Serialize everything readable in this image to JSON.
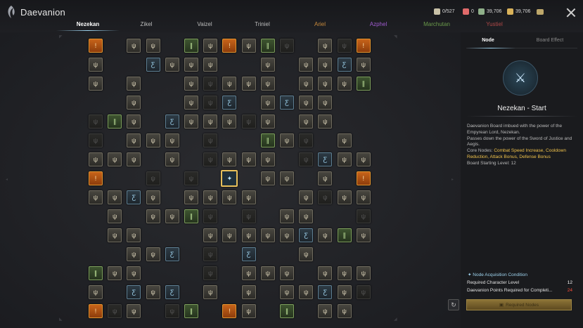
{
  "app": {
    "title": "Daevanion",
    "logo_icon": "daevanion-logo-icon"
  },
  "resources": [
    {
      "icon": "point-card-icon",
      "value": "0/527",
      "color": "#c9c2a8"
    },
    {
      "icon": "red-gem-icon",
      "value": "0",
      "color": "#e06a6a"
    },
    {
      "icon": "green-orb-icon",
      "value": "39,706",
      "color": "#8fb08a"
    },
    {
      "icon": "kinah-coin-icon",
      "value": "39,706",
      "color": "#d9b25a"
    }
  ],
  "tabs": [
    {
      "label": "Nezekan",
      "color": "#ffffff",
      "active": true
    },
    {
      "label": "Zikel",
      "color": "#bdbdbd"
    },
    {
      "label": "Vaizel",
      "color": "#bdbdbd"
    },
    {
      "label": "Triniel",
      "color": "#bdbdbd"
    },
    {
      "label": "Ariel",
      "color": "#c98a3c"
    },
    {
      "label": "Azphel",
      "color": "#a05bd0"
    },
    {
      "label": "Marchutan",
      "color": "#6a9a4a"
    },
    {
      "label": "Yustiel",
      "color": "#b04848"
    }
  ],
  "panel": {
    "tab_node": "Node",
    "tab_board_effect": "Board Effect",
    "node_name": "Nezekan - Start",
    "desc_line1": "Daevanion Board imbued with the power of the Empyrean Lord, Nezekan.",
    "desc_line2": "Passes down the power of the Sword of Justice and Aegis.",
    "core_nodes_label": "Core Nodes:",
    "core_nodes": "Combat Speed Increase, Cooldown Reduction, Attack Bonus, Defense Bonus",
    "board_level": "Board Starting Level: 12",
    "condition_title": "Node Acquisition Condition",
    "req_level_label": "Required Character Level",
    "req_level_value": "12",
    "req_points_label": "Daevanion Points Required for Completi...",
    "req_points_value": "24",
    "acquire_button": "Required Nodes"
  },
  "board": {
    "rows": [
      "O_NN.GNONGD.NDO",
      "N..BNNN..N.NNBN",
      "N.N..NDNNN.NNNG",
      "..N..NDB.NBNN..",
      "DGN.BNNNDN.NN..",
      "D.NNN.D..GND.N.",
      "NNN.N.DNNN.DBNN",
      "O..D.D.S.NN.N.O",
      "NNBN.NNNN..NDNN",
      ".N.NNGD.D.NN..D",
      ".NN...NNNNNBNGN",
      "..NNB.D.B..N...",
      "GNN...D.NNN.NNN",
      "N.BNB.N.N.NNBND",
      "ODN.DG.ON.G.NN."
    ]
  }
}
